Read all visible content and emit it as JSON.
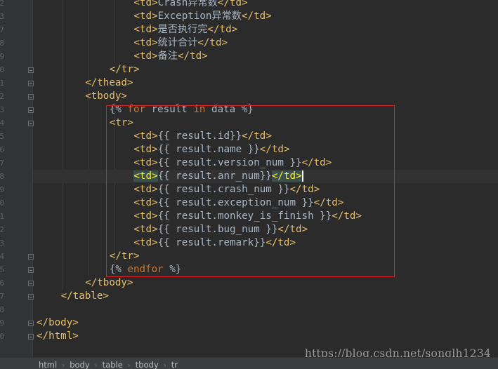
{
  "editor": {
    "line_numbers": [
      "2",
      "3",
      "7",
      "8",
      "9",
      "0",
      "1",
      "2",
      "3",
      "4",
      "5",
      "6",
      "7",
      "8",
      "9",
      "0",
      "1",
      "2",
      "3",
      "4",
      "5",
      "6",
      "7",
      "8",
      "9",
      "0"
    ],
    "lines": [
      [
        {
          "t": "<td>",
          "c": "t"
        },
        {
          "t": "Crash异常数",
          "c": "txt"
        },
        {
          "t": "</td>",
          "c": "t"
        }
      ],
      [
        {
          "t": "<td>",
          "c": "t"
        },
        {
          "t": "Exception异常数",
          "c": "txt"
        },
        {
          "t": "</td>",
          "c": "t"
        }
      ],
      [
        {
          "t": "<td>",
          "c": "t"
        },
        {
          "t": "是否执行完",
          "c": "txt"
        },
        {
          "t": "</td>",
          "c": "t"
        }
      ],
      [
        {
          "t": "<td>",
          "c": "t"
        },
        {
          "t": "统计合计",
          "c": "txt"
        },
        {
          "t": "</td>",
          "c": "t"
        }
      ],
      [
        {
          "t": "<td>",
          "c": "t"
        },
        {
          "t": "备注",
          "c": "txt"
        },
        {
          "t": "</td>",
          "c": "t"
        }
      ],
      [
        {
          "t": "</tr>",
          "c": "t"
        }
      ],
      [
        {
          "t": "</thead>",
          "c": "t"
        }
      ],
      [
        {
          "t": "<tbody>",
          "c": "t"
        }
      ],
      [
        {
          "t": "{% ",
          "c": "txt"
        },
        {
          "t": "for",
          "c": "kw"
        },
        {
          "t": " result ",
          "c": "txt"
        },
        {
          "t": "in",
          "c": "kw"
        },
        {
          "t": " data %}",
          "c": "txt"
        }
      ],
      [
        {
          "t": "<tr>",
          "c": "t"
        }
      ],
      [
        {
          "t": "<td>",
          "c": "t"
        },
        {
          "t": "{{ result.id}}",
          "c": "txt"
        },
        {
          "t": "</td>",
          "c": "t"
        }
      ],
      [
        {
          "t": "<td>",
          "c": "t"
        },
        {
          "t": "{{ result.name }}",
          "c": "txt"
        },
        {
          "t": "</td>",
          "c": "t"
        }
      ],
      [
        {
          "t": "<td>",
          "c": "t"
        },
        {
          "t": "{{ result.version_num }}",
          "c": "txt"
        },
        {
          "t": "</td>",
          "c": "t"
        }
      ],
      [
        {
          "t": "<td>",
          "c": "hl"
        },
        {
          "t": "{{ result.anr_num}}",
          "c": "txt"
        },
        {
          "t": "</td>",
          "c": "hl"
        }
      ],
      [
        {
          "t": "<td>",
          "c": "t"
        },
        {
          "t": "{{ result.crash_num }}",
          "c": "txt"
        },
        {
          "t": "</td>",
          "c": "t"
        }
      ],
      [
        {
          "t": "<td>",
          "c": "t"
        },
        {
          "t": "{{ result.exception_num }}",
          "c": "txt"
        },
        {
          "t": "</td>",
          "c": "t"
        }
      ],
      [
        {
          "t": "<td>",
          "c": "t"
        },
        {
          "t": "{{ result.monkey_is_finish }}",
          "c": "txt"
        },
        {
          "t": "</td>",
          "c": "t"
        }
      ],
      [
        {
          "t": "<td>",
          "c": "t"
        },
        {
          "t": "{{ result.bug_num }}",
          "c": "txt"
        },
        {
          "t": "</td>",
          "c": "t"
        }
      ],
      [
        {
          "t": "<td>",
          "c": "t"
        },
        {
          "t": "{{ result.remark}}",
          "c": "txt"
        },
        {
          "t": "</td>",
          "c": "t"
        }
      ],
      [
        {
          "t": "</tr>",
          "c": "t"
        }
      ],
      [
        {
          "t": "{% ",
          "c": "txt"
        },
        {
          "t": "endfor",
          "c": "kw"
        },
        {
          "t": " %}",
          "c": "txt"
        }
      ],
      [
        {
          "t": "</tbody>",
          "c": "t"
        }
      ],
      [
        {
          "t": "</table>",
          "c": "t"
        }
      ],
      [],
      [
        {
          "t": "</body>",
          "c": "t"
        }
      ],
      [
        {
          "t": "</html>",
          "c": "t"
        }
      ]
    ]
  },
  "watermark": "https://blog.csdn.net/songlh1234",
  "breadcrumb": [
    "html",
    "body",
    "table",
    "tbody",
    "tr"
  ],
  "colors": {
    "background": "#2b2b2b",
    "tag": "#e8bf6a",
    "text": "#a9b7c6",
    "keyword": "#cc7832",
    "highlight_box": "#e02020"
  }
}
